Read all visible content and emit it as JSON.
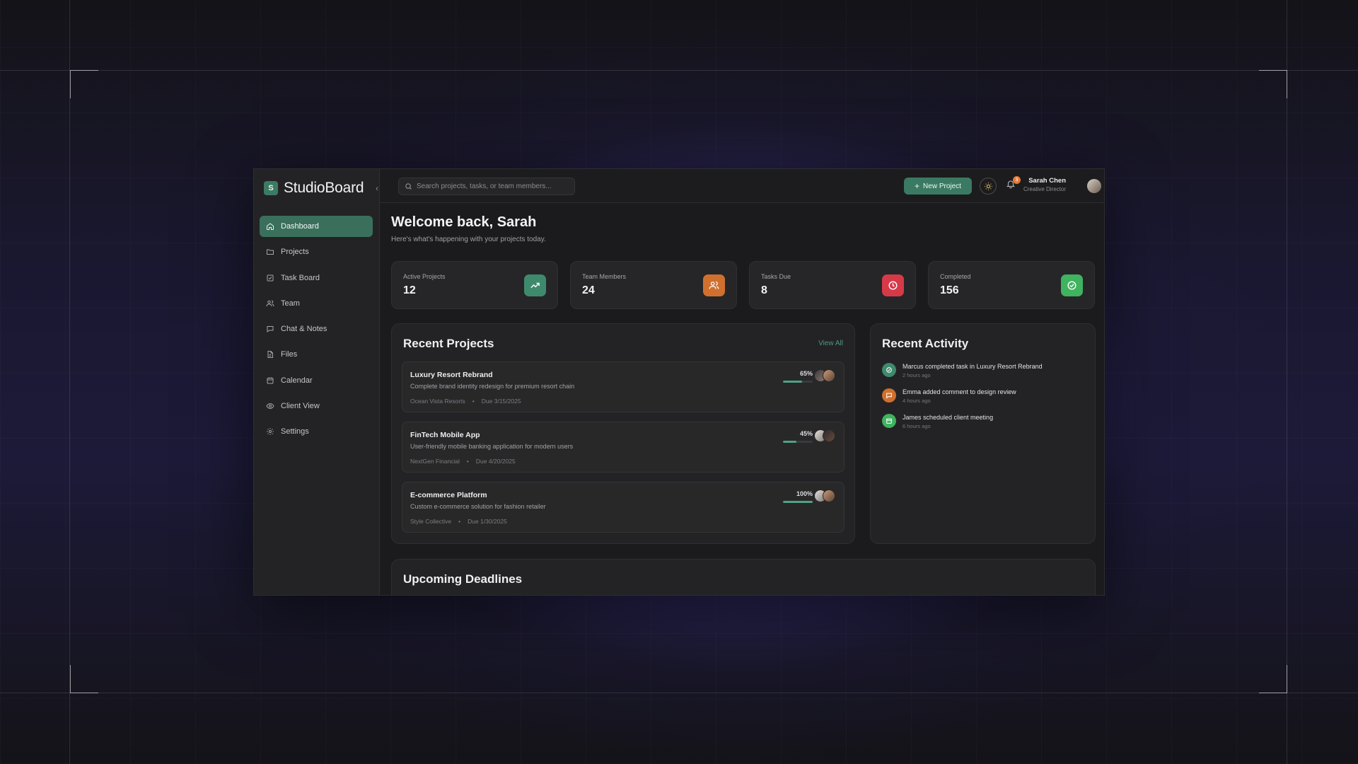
{
  "app": {
    "brand_initial": "S",
    "brand_name": "StudioBoard",
    "accent": "#3a6f5c"
  },
  "sidebar": {
    "items": [
      {
        "label": "Dashboard",
        "icon": "home-icon",
        "active": true
      },
      {
        "label": "Projects",
        "icon": "folder-icon",
        "active": false
      },
      {
        "label": "Task Board",
        "icon": "checkbox-icon",
        "active": false
      },
      {
        "label": "Team",
        "icon": "users-icon",
        "active": false
      },
      {
        "label": "Chat & Notes",
        "icon": "chat-icon",
        "active": false
      },
      {
        "label": "Files",
        "icon": "file-icon",
        "active": false
      },
      {
        "label": "Calendar",
        "icon": "calendar-icon",
        "active": false
      },
      {
        "label": "Client View",
        "icon": "eye-icon",
        "active": false
      },
      {
        "label": "Settings",
        "icon": "gear-icon",
        "active": false
      }
    ]
  },
  "topbar": {
    "search_placeholder": "Search projects, tasks, or team members...",
    "new_project_label": "New Project",
    "notification_count": "3",
    "user_name": "Sarah Chen",
    "user_role": "Creative Director"
  },
  "main": {
    "welcome": "Welcome back, Sarah",
    "subtitle": "Here's what's happening with your projects today.",
    "stats": [
      {
        "label": "Active Projects",
        "value": "12",
        "icon": "trending-up-icon",
        "color": "#3f8a6d"
      },
      {
        "label": "Team Members",
        "value": "24",
        "icon": "users-icon",
        "color": "#d0702e"
      },
      {
        "label": "Tasks Due",
        "value": "8",
        "icon": "clock-icon",
        "color": "#d63a48"
      },
      {
        "label": "Completed",
        "value": "156",
        "icon": "check-circle-icon",
        "color": "#3fb35f"
      }
    ],
    "recent_projects": {
      "title": "Recent Projects",
      "view_all": "View All",
      "items": [
        {
          "name": "Luxury Resort Rebrand",
          "description": "Complete brand identity redesign for premium resort chain",
          "client": "Ocean Vista Resorts",
          "due": "Due 3/15/2025",
          "percent_label": "65%",
          "progress": 0.65
        },
        {
          "name": "FinTech Mobile App",
          "description": "User-friendly mobile banking application for modern users",
          "client": "NextGen Financial",
          "due": "Due 4/20/2025",
          "percent_label": "45%",
          "progress": 0.45
        },
        {
          "name": "E-commerce Platform",
          "description": "Custom e-commerce solution for fashion retailer",
          "client": "Style Collective",
          "due": "Due 1/30/2025",
          "percent_label": "100%",
          "progress": 1.0
        }
      ]
    },
    "recent_activity": {
      "title": "Recent Activity",
      "items": [
        {
          "text": "Marcus completed task in Luxury Resort Rebrand",
          "time": "2 hours ago",
          "icon": "check-icon",
          "color": "#3f8a6d"
        },
        {
          "text": "Emma added comment to design review",
          "time": "4 hours ago",
          "icon": "comment-icon",
          "color": "#d0702e"
        },
        {
          "text": "James scheduled client meeting",
          "time": "6 hours ago",
          "icon": "calendar-icon",
          "color": "#3fb35f"
        }
      ]
    },
    "upcoming_deadlines": {
      "title": "Upcoming Deadlines"
    }
  }
}
